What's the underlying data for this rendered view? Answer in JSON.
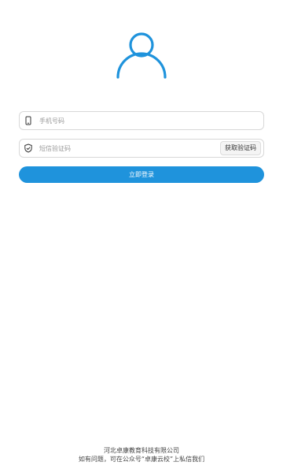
{
  "colors": {
    "accent": "#1f93dc",
    "border": "#d8d8d8",
    "placeholder": "#9a9a9a"
  },
  "icons": {
    "avatar": "user-icon",
    "phone_field": "mobile-phone-icon",
    "code_field": "shield-check-icon"
  },
  "form": {
    "phone_placeholder": "手机号码",
    "code_placeholder": "短信验证码",
    "get_code_label": "获取验证码",
    "login_label": "立即登录"
  },
  "footer": {
    "company": "河北卓康教育科技有限公司",
    "contact": "如有问题，可在公众号“卓康云校”上私信我们"
  }
}
